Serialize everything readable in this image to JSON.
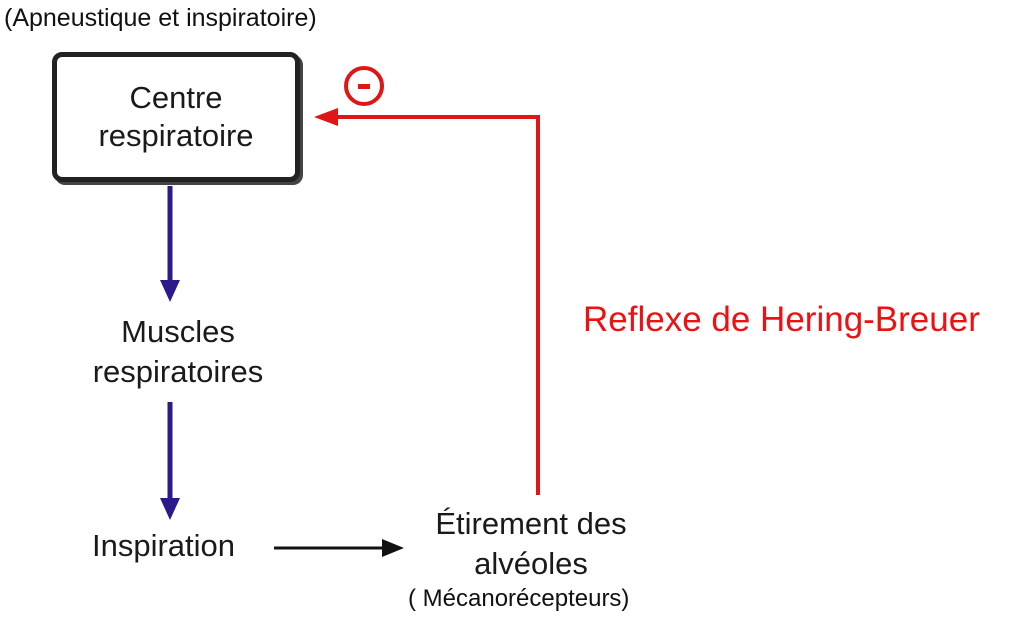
{
  "diagram": {
    "top_note": "(Apneustique et inspiratoire)",
    "centre": {
      "line1": "Centre",
      "line2": "respiratoire"
    },
    "muscles": {
      "line1": "Muscles",
      "line2": "respiratoires"
    },
    "inspiration": "Inspiration",
    "etirement": {
      "line1": "Étirement des",
      "line2": "alvéoles"
    },
    "mecanorecepteurs": "( Mécanorécepteurs)",
    "reflex_label": "Reflexe de Hering-Breuer",
    "inhibition_symbol": "minus-in-circle",
    "colors": {
      "box_border": "#222222",
      "forward_arrow": "#2b1a8a",
      "feedback_arrow": "#e01515",
      "reflex_text": "#ee1111",
      "text": "#1a1a1a"
    }
  }
}
